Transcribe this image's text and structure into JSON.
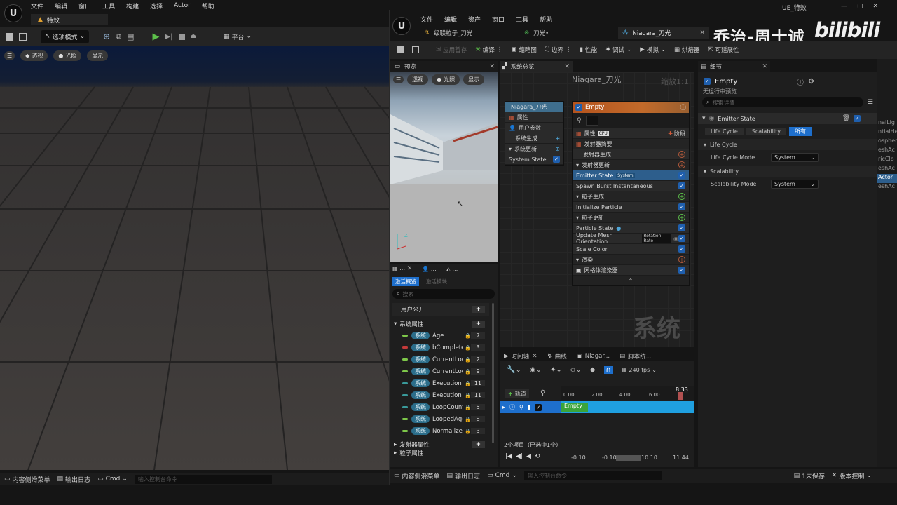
{
  "title_bar": {
    "menu": [
      "文件",
      "编辑",
      "窗口",
      "工具",
      "构建",
      "选择",
      "Actor",
      "帮助"
    ],
    "tab": "特效",
    "window_title": "UE_特效"
  },
  "main_toolbar": {
    "select_mode": "选项模式",
    "platform": "平台"
  },
  "viewport": {
    "perspective": "透视",
    "lighting": "光照",
    "show": "显示"
  },
  "niagara": {
    "menu": [
      "文件",
      "编辑",
      "资产",
      "窗口",
      "工具",
      "帮助"
    ],
    "doc_tabs": [
      "级联粒子_刀光",
      "刀光•",
      "Niagara_刀光"
    ],
    "toolbar": [
      "应用暂存",
      "编译",
      "缩略图",
      "边界",
      "性能",
      "调试",
      "模拟",
      "烘焙器",
      "可延展性"
    ],
    "watermark": "乔治-周士诚",
    "watermark_logo": "bilibili",
    "preview": {
      "tab": "预览",
      "perspective": "透视",
      "lighting": "光照",
      "show": "显示",
      "axis_z": "Z"
    },
    "overview": {
      "tab": "系统总览",
      "title": "Niagara_刀光",
      "zoom": "缩放1:1",
      "system_node": {
        "title": "Niagara_刀光",
        "items": [
          "属性",
          "用户参数",
          "系统生成",
          "系统更新",
          "System State"
        ]
      },
      "emitter_node": {
        "title": "Empty",
        "props": "属性",
        "cpu": "CPU",
        "stage": "阶段",
        "items": [
          "发射器摘要",
          "发射器生成",
          "发射器更新",
          "Emitter State",
          "Spawn Burst Instantaneous",
          "粒子生成",
          "Initialize Particle",
          "粒子更新",
          "Particle State",
          "Update Mesh Orientation",
          "Scale Color",
          "渲染",
          "网格体渲染器"
        ],
        "tag_system": "System",
        "tag_rotation": "Rotation Rate"
      },
      "bg_label": "系统"
    },
    "details": {
      "tab": "细节",
      "name": "Empty",
      "no_preview": "无运行中预览",
      "search": "搜索详情",
      "section": "Emitter State",
      "filters": [
        "Life Cycle",
        "Scalability",
        "所有"
      ],
      "groups": [
        {
          "title": "Life Cycle",
          "label": "Life Cycle Mode",
          "value": "System"
        },
        {
          "title": "Scalability",
          "label": "Scalability Mode",
          "value": "System"
        }
      ]
    },
    "params": {
      "tabs": [
        "激活概览",
        "激活模块"
      ],
      "search": "搜索",
      "user_exposed": "用户公开",
      "system_attrs": "系统属性",
      "sys_tag": "系统",
      "attrs": [
        {
          "name": "Age",
          "n": "7",
          "c": "#7ec84a"
        },
        {
          "name": "bComplete",
          "n": "3",
          "c": "#c43a3a"
        },
        {
          "name": "CurrentLoc",
          "n": "2",
          "c": "#7ec84a"
        },
        {
          "name": "CurrentLoc",
          "n": "9",
          "c": "#7ec84a"
        },
        {
          "name": "Execution",
          "n": "11",
          "c": "#3a9a9a"
        },
        {
          "name": "Execution",
          "n": "11",
          "c": "#3a9a9a"
        },
        {
          "name": "LoopCount",
          "n": "5",
          "c": "#3a9a9a"
        },
        {
          "name": "LoopedAge",
          "n": "8",
          "c": "#7ec84a"
        },
        {
          "name": "Normalized",
          "n": "3",
          "c": "#7ec84a"
        }
      ],
      "emitter_attrs": "发射器属性",
      "particle_attrs": "粒子属性"
    },
    "timeline": {
      "tabs": [
        "时间轴",
        "曲线",
        "Niagar...",
        "脚本统..."
      ],
      "fps": "240 fps",
      "track": "轨道",
      "ticks": [
        "0.00",
        "2.00",
        "4.00",
        "6.00"
      ],
      "end": "8.33",
      "bar": "Empty",
      "count": "2个项目（已选中1个）",
      "start": "-0.10",
      "range_a": "-0.10",
      "range_b": "10.10",
      "end_time": "11.44",
      "unsaved": "1未保存",
      "source": "版本控制"
    }
  },
  "right_cut": {
    "items": [
      "nalLig",
      "ntialHe",
      "ospher",
      "eshAc",
      "ricClo",
      "eshAc",
      "Actor",
      "eshAc"
    ]
  },
  "status_bar": {
    "drawer": "内容侧滑菜单",
    "output": "输出日志",
    "cmd": "Cmd",
    "console": "输入控制台命令"
  }
}
